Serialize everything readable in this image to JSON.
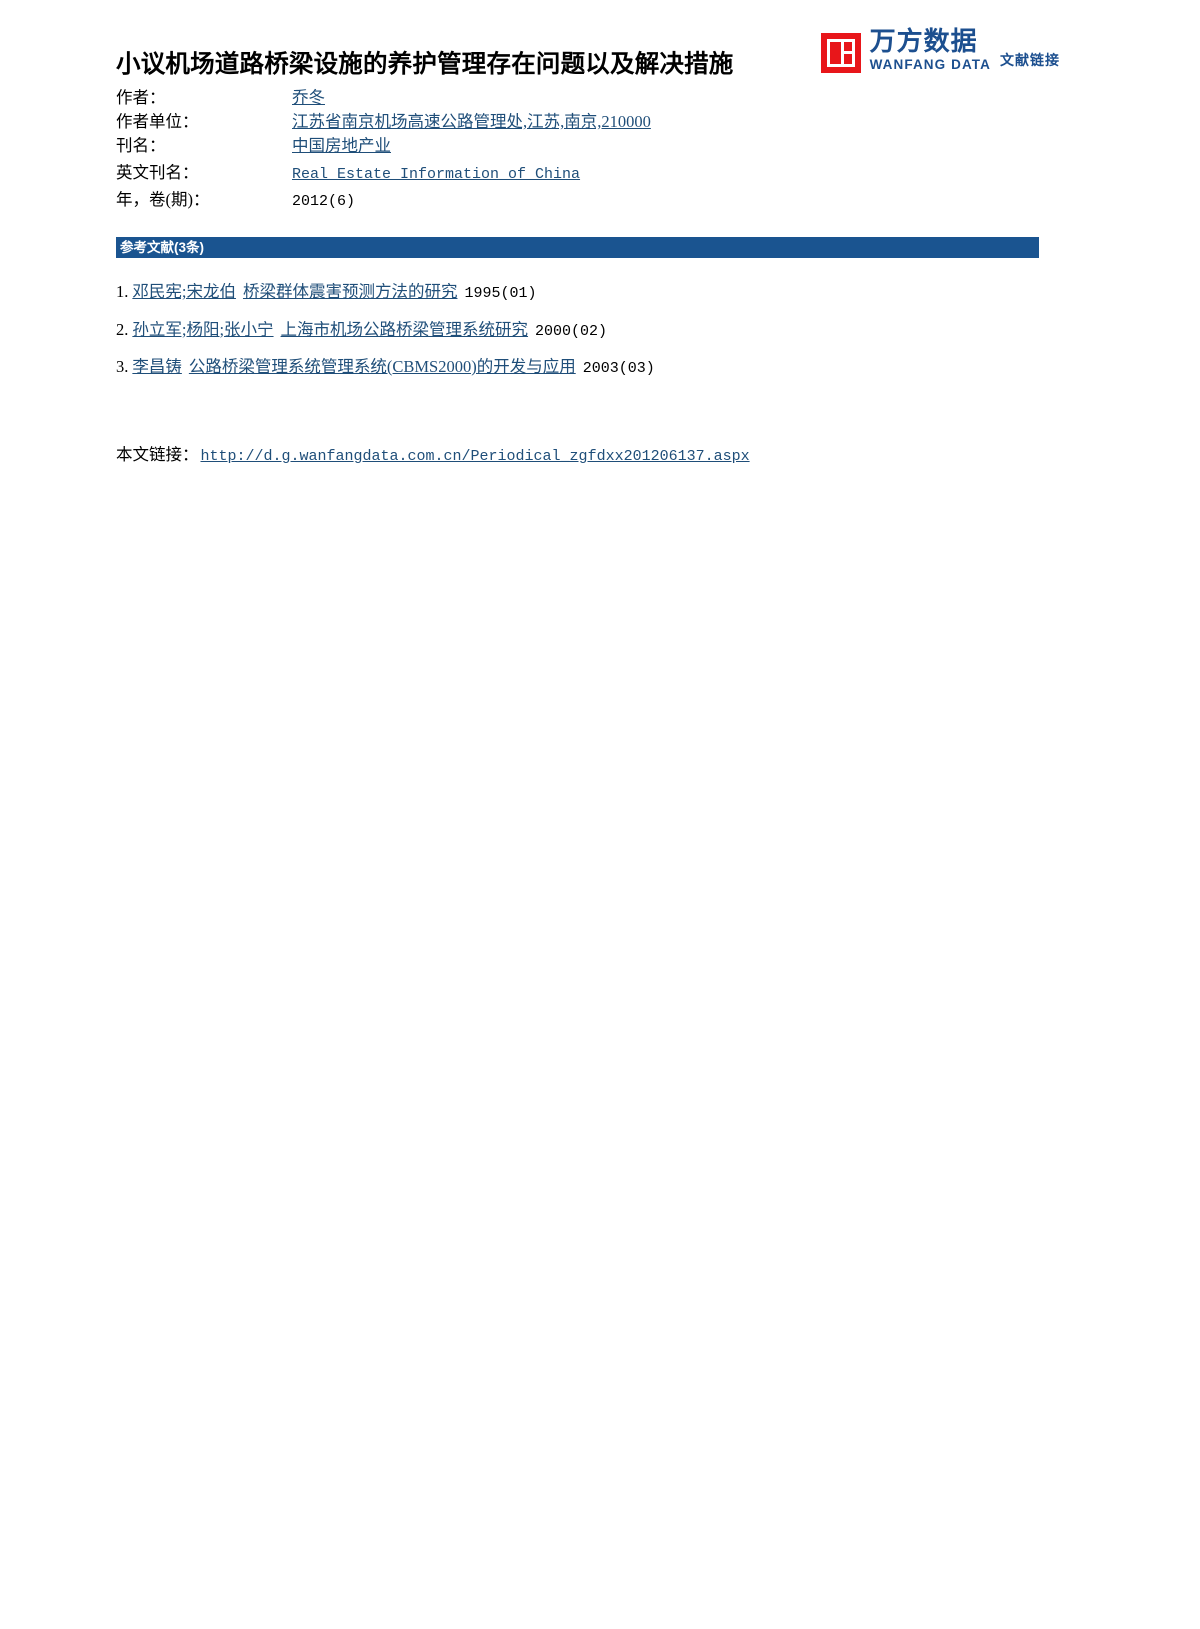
{
  "logo": {
    "mark_color": "#e8161a",
    "text_color": "#1c4f8f",
    "chinese_name": "万方数据",
    "english_name": "WANFANG DATA",
    "tagline": "文献链接"
  },
  "document": {
    "title": "小议机场道路桥梁设施的养护管理存在问题以及解决措施"
  },
  "metadata": {
    "rows": [
      {
        "label": "作者：",
        "value": "乔冬"
      },
      {
        "label": "作者单位：",
        "value": "江苏省南京机场高速公路管理处,江苏,南京,210000"
      },
      {
        "label": "刊名：",
        "value": "中国房地产业"
      },
      {
        "label": "英文刊名：",
        "value": "Real Estate Information of China"
      },
      {
        "label": "年，卷(期)：",
        "value": "2012(6)"
      }
    ]
  },
  "references_section": {
    "header": "参考文献(3条)",
    "header_color": "#1a5490",
    "items": [
      {
        "index": "1.",
        "authors": "邓民宪;宋龙伯",
        "title": "桥梁群体震害预测方法的研究",
        "year": "1995(01)"
      },
      {
        "index": "2.",
        "authors": "孙立军;杨阳;张小宁",
        "title": "上海市机场公路桥梁管理系统研究",
        "year": "2000(02)"
      },
      {
        "index": "3.",
        "authors": "李昌铸",
        "title": "公路桥梁管理系统管理系统(CBMS2000)的开发与应用",
        "year": "2003(03)"
      }
    ]
  },
  "footer": {
    "label": "本文链接：",
    "url": "http://d.g.wanfangdata.com.cn/Periodical_zgfdxx201206137.aspx"
  }
}
